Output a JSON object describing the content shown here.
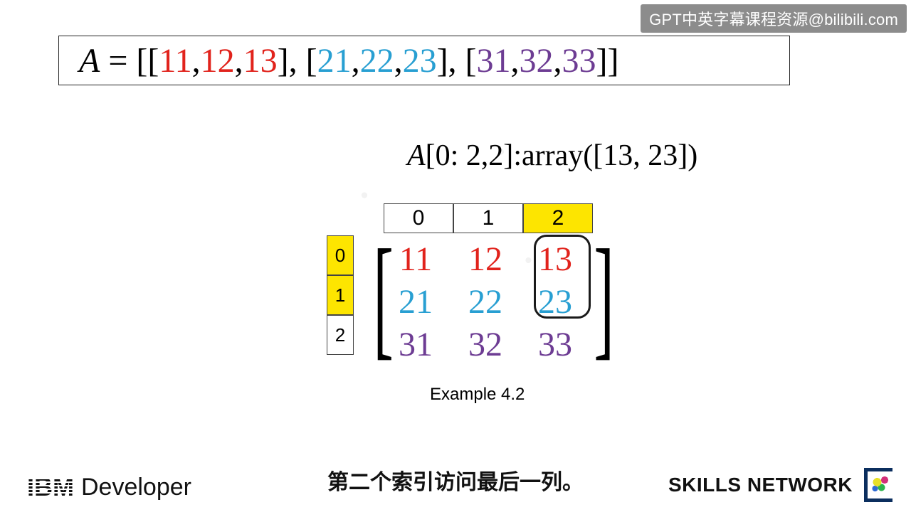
{
  "watermark": "GPT中英字幕课程资源@bilibili.com",
  "equation": {
    "var": "A",
    "eq": "=",
    "sets": {
      "r1": [
        "11",
        "12",
        "13"
      ],
      "r2": [
        "21",
        "22",
        "23"
      ],
      "r3": [
        "31",
        "32",
        "33"
      ]
    }
  },
  "slice": {
    "var": "A",
    "expr": "[0: 2,2]",
    "label": ":array(",
    "open": "[",
    "v1": "13",
    "sep": ", ",
    "v2": "23",
    "close": "])"
  },
  "matrix": {
    "col_headers": [
      "0",
      "1",
      "2"
    ],
    "row_headers": [
      "0",
      "1",
      "2"
    ],
    "rows": [
      [
        "11",
        "12",
        "13"
      ],
      [
        "21",
        "22",
        "23"
      ],
      [
        "31",
        "32",
        "33"
      ]
    ],
    "selection_cols": [
      2
    ],
    "selection_rows": [
      0,
      1
    ]
  },
  "example_label": "Example 4.2",
  "subtitle": "第二个索引访问最后一列。",
  "logo_left": {
    "brand": "IBM",
    "product": "Developer"
  },
  "logo_right": {
    "text": "SKILLS NETWORK"
  },
  "chart_data": {
    "type": "table",
    "title": "2D numpy array A with slice A[0:2,2]",
    "columns": [
      "0",
      "1",
      "2"
    ],
    "rows": [
      "0",
      "1",
      "2"
    ],
    "values": [
      [
        11,
        12,
        13
      ],
      [
        21,
        22,
        23
      ],
      [
        31,
        32,
        33
      ]
    ],
    "highlighted_rows": [
      0,
      1
    ],
    "highlighted_cols": [
      2
    ],
    "slice_result": [
      13,
      23
    ]
  }
}
